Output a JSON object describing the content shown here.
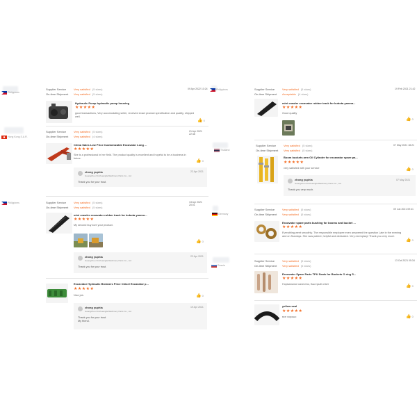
{
  "labels": {
    "supplier_service": "Supplier Service",
    "ontime_shipment": "On-time Shipment",
    "very_satisfied": "Very satisfied",
    "acceptable": "Acceptable",
    "stars_5": "(5 stars)",
    "stars_4": "(4 stars)",
    "rating_stars": "★★★★★",
    "like_count": "0"
  },
  "left": [
    {
      "country": "Philippines",
      "date": "09 Apr 2022 10:24",
      "shipment_value": "Very satisfied",
      "shipment_stars": "(5 stars)",
      "product": "Hydraulic Pump hydraulic pump housing",
      "text": "good transactions, Very accomodating seller, received exact product specification and quality, shipped well.",
      "thumb": "excavator-pump"
    },
    {
      "country": "Hong Kong S.A.R.",
      "date": "21 Apr 2021 22:48",
      "shipment_value": "Very satisfied",
      "shipment_stars": "(4 stars)",
      "product": "China Sales Low Price Customizable Excavator Long ...",
      "text": "She is a professional in her field. The product quality is excellent and hopeful to be a business in future.",
      "thumb": "long-reach-boom",
      "reply": {
        "name": "zhong yuphia",
        "company": "Guangzhou Xinchuangfa Machinery Parts Co., Ltd",
        "date": "22 Apr 2021",
        "text": "Thank you for your trust."
      }
    },
    {
      "country": "Philippines",
      "date": "13 Apr 2021 20:01",
      "shipment_value": "Very satisfied",
      "shipment_stars": "(5 stars)",
      "product": "mini crawler excavator rubber track for kubota yanmo...",
      "text": "My second buy love your product.",
      "thumb": "rubber-track",
      "photos": [
        "field-photo-1",
        "field-photo-2"
      ],
      "reply": {
        "name": "zhong yuphia",
        "company": "Guangzhou Xinchuangfa Machinery Parts Co., Ltd",
        "date": "22 Apr 2021",
        "text": "Thank you for your trust."
      }
    },
    {
      "product": "Excavator Hydraulic Breakers Price Chisel Excavator p...",
      "text": "Nice job.",
      "thumb": "hydraulic-breaker",
      "reply": {
        "name": "zhong yuphia",
        "company": "Guangzhou Xinchuangfa Machinery Parts Co., Ltd",
        "date": "19 Apr 2021",
        "text": "Thank you for your trust.\nMy friend."
      }
    }
  ],
  "right": [
    {
      "country": "Philippines",
      "date": "19 Feb 2021 21:42",
      "shipment_value": "Acceptable",
      "shipment_stars": "(4 stars)",
      "product": "mini crawler excavator rubber track for kubota yanma...",
      "text": "Good quality",
      "thumb": "rubber-track",
      "photos": [
        "field-photo-3"
      ]
    },
    {
      "country": "Thailand",
      "date": "07 May 2021 18:21",
      "shipment_value": "Very satisfied",
      "shipment_stars": "(5 stars)",
      "product": "Boom buckets arm Oil Cylinder for excavator spare pa...",
      "text": "very satisfied with your service",
      "thumb": "oil-cylinders",
      "reply": {
        "name": "zhong yuphia",
        "company": "Guangzhou Xinchuangfa Machinery Parts Co., Ltd",
        "date": "07 May 2021",
        "text": "Thank you very much."
      }
    },
    {
      "country": "Germany",
      "date": "09 Jun 2021 09:41",
      "shipment_value": "Very satisfied",
      "shipment_stars": "(5 stars)",
      "product": "Excavator spare parts bushing for booms and bucket ...",
      "text": "Everything went smoothly. The responsible employee even answered the question Late in the evening and on Sundays. She was patient, helpful and dedicated. Very exemplary! Thank you very much",
      "thumb": "bushings"
    },
    {
      "country": "Russia",
      "date": "13 Oct 2021 05:34",
      "shipment_value": "Very satisfied",
      "shipment_stars": "(5 stars)",
      "product": "Excavator Spare Parts TPU Seals for Buckets O ring S...",
      "text": "Нормальное качество, Быстрый ответ",
      "thumb": "tpu-seals"
    },
    {
      "product": "yellow seal",
      "text": "все хорошо",
      "thumb": "black-track"
    }
  ]
}
